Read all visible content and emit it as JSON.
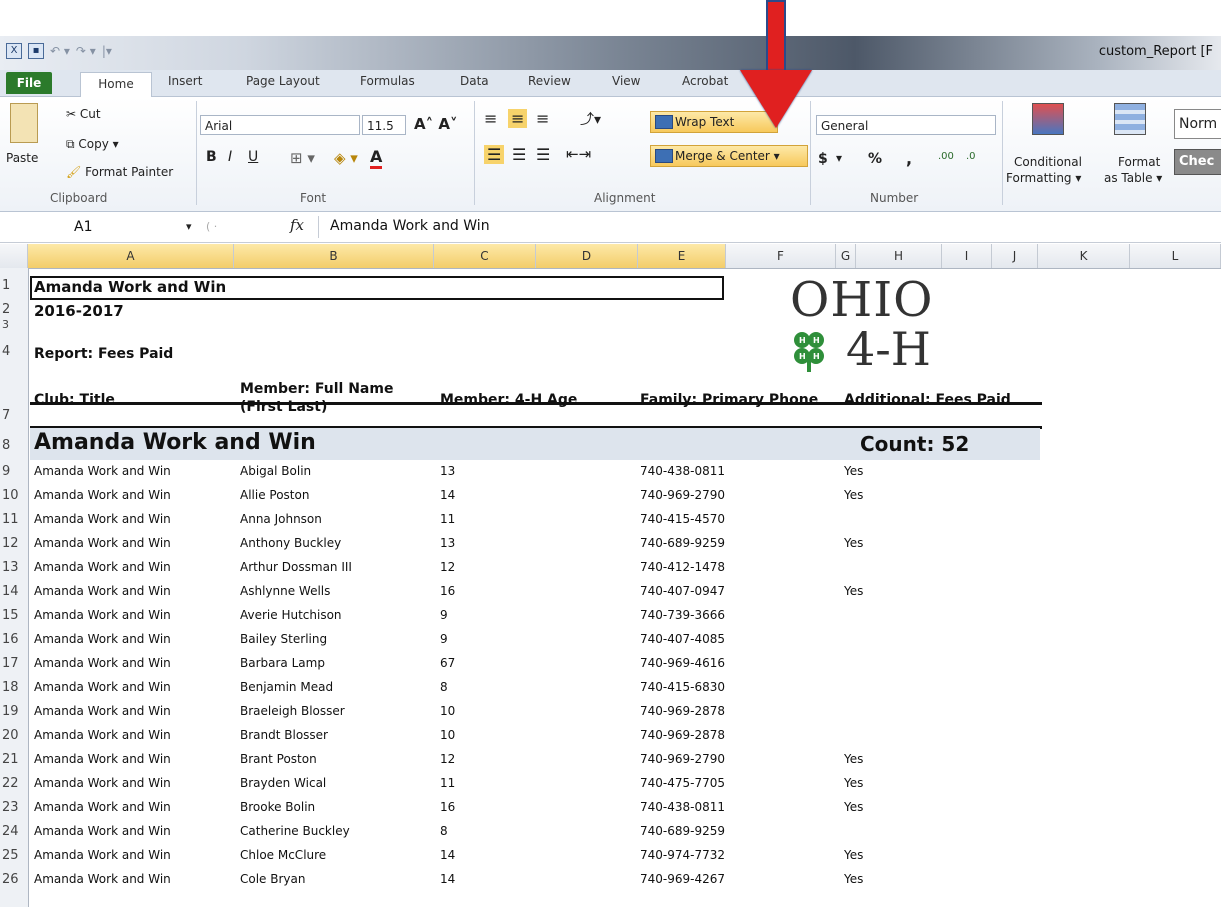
{
  "window": {
    "title": "custom_Report [F"
  },
  "tabs": [
    "File",
    "Home",
    "Insert",
    "Page Layout",
    "Formulas",
    "Data",
    "Review",
    "View",
    "Acrobat"
  ],
  "ribbon": {
    "clipboard": {
      "paste": "Paste",
      "cut": "Cut",
      "copy": "Copy ▾",
      "format_painter": "Format Painter",
      "label": "Clipboard"
    },
    "font": {
      "name": "Arial",
      "size": "11.5",
      "label": "Font",
      "bold": "B",
      "italic": "I",
      "underline": "U"
    },
    "alignment": {
      "wrap_text": "Wrap Text",
      "merge_center": "Merge & Center",
      "label": "Alignment"
    },
    "number": {
      "format": "General",
      "currency": "$",
      "percent": "%",
      "comma": ",",
      "inc_dec": ".00",
      "dec_dec": ".0",
      "label": "Number"
    },
    "styles": {
      "conditional": "Conditional",
      "conditional2": "Formatting ▾",
      "format_as": "Format",
      "format_as2": "as Table ▾",
      "normal": "Norm",
      "check": "Chec"
    }
  },
  "formula_bar": {
    "name_box": "A1",
    "fx": "fx",
    "content": "Amanda Work and Win"
  },
  "columns": [
    "A",
    "B",
    "C",
    "D",
    "E",
    "F",
    "G",
    "H",
    "I",
    "J",
    "K",
    "L"
  ],
  "row_numbers": [
    "1",
    "2",
    "3",
    "4",
    "7",
    "8",
    "9",
    "10",
    "11",
    "12",
    "13",
    "14",
    "15",
    "16",
    "17",
    "18",
    "19",
    "20",
    "21",
    "22",
    "23",
    "24",
    "25",
    "26"
  ],
  "report": {
    "title": "Amanda Work and Win",
    "year": "2016-2017",
    "report_name": "Report: Fees Paid",
    "logo_top": "OHIO",
    "logo_bottom": "4-H",
    "headers": {
      "club": "Club: Title",
      "member_name_1": "Member: Full Name",
      "member_name_2": "(First Last)",
      "age": "Member: 4-H Age",
      "phone": "Family: Primary Phone",
      "fees": "Additional: Fees Paid"
    },
    "group_title": "Amanda Work and Win",
    "group_count": "Count: 52"
  },
  "rows": [
    {
      "club": "Amanda Work and Win",
      "name": "Abigal Bolin",
      "age": "13",
      "phone": "740-438-0811",
      "fees": "Yes"
    },
    {
      "club": "Amanda Work and Win",
      "name": "Allie Poston",
      "age": "14",
      "phone": "740-969-2790",
      "fees": "Yes"
    },
    {
      "club": "Amanda Work and Win",
      "name": "Anna Johnson",
      "age": "11",
      "phone": "740-415-4570",
      "fees": ""
    },
    {
      "club": "Amanda Work and Win",
      "name": "Anthony Buckley",
      "age": "13",
      "phone": "740-689-9259",
      "fees": "Yes"
    },
    {
      "club": "Amanda Work and Win",
      "name": "Arthur Dossman III",
      "age": "12",
      "phone": "740-412-1478",
      "fees": ""
    },
    {
      "club": "Amanda Work and Win",
      "name": "Ashlynne Wells",
      "age": "16",
      "phone": "740-407-0947",
      "fees": "Yes"
    },
    {
      "club": "Amanda Work and Win",
      "name": "Averie Hutchison",
      "age": "9",
      "phone": "740-739-3666",
      "fees": ""
    },
    {
      "club": "Amanda Work and Win",
      "name": "Bailey Sterling",
      "age": "9",
      "phone": "740-407-4085",
      "fees": ""
    },
    {
      "club": "Amanda Work and Win",
      "name": "Barbara Lamp",
      "age": "67",
      "phone": "740-969-4616",
      "fees": ""
    },
    {
      "club": "Amanda Work and Win",
      "name": "Benjamin Mead",
      "age": "8",
      "phone": "740-415-6830",
      "fees": ""
    },
    {
      "club": "Amanda Work and Win",
      "name": "Braeleigh Blosser",
      "age": "10",
      "phone": "740-969-2878",
      "fees": ""
    },
    {
      "club": "Amanda Work and Win",
      "name": "Brandt Blosser",
      "age": "10",
      "phone": "740-969-2878",
      "fees": ""
    },
    {
      "club": "Amanda Work and Win",
      "name": "Brant Poston",
      "age": "12",
      "phone": "740-969-2790",
      "fees": "Yes"
    },
    {
      "club": "Amanda Work and Win",
      "name": "Brayden Wical",
      "age": "11",
      "phone": "740-475-7705",
      "fees": "Yes"
    },
    {
      "club": "Amanda Work and Win",
      "name": "Brooke Bolin",
      "age": "16",
      "phone": "740-438-0811",
      "fees": "Yes"
    },
    {
      "club": "Amanda Work and Win",
      "name": "Catherine Buckley",
      "age": "8",
      "phone": "740-689-9259",
      "fees": ""
    },
    {
      "club": "Amanda Work and Win",
      "name": "Chloe McClure",
      "age": "14",
      "phone": "740-974-7732",
      "fees": "Yes"
    },
    {
      "club": "Amanda Work and Win",
      "name": "Cole Bryan",
      "age": "14",
      "phone": "740-969-4267",
      "fees": "Yes"
    }
  ],
  "colors": {
    "file_tab": "#2b7a2b",
    "arrow": "#e02020",
    "logo_green": "#2f8f3a"
  }
}
